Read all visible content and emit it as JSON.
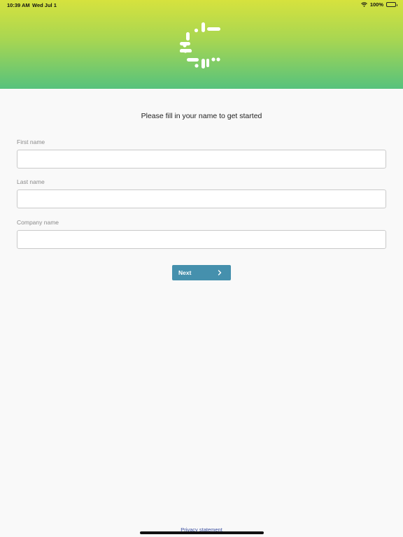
{
  "status_bar": {
    "time": "10:39 AM",
    "date": "Wed Jul 1",
    "battery": "100%"
  },
  "header": {
    "logo_icon": "dotted-c-logo-icon",
    "gradient_colors": [
      "#d6e23e",
      "#56c27d"
    ]
  },
  "form": {
    "prompt": "Please fill in your name to get started",
    "fields": [
      {
        "label": "First name",
        "value": ""
      },
      {
        "label": "Last name",
        "value": ""
      },
      {
        "label": "Company name",
        "value": ""
      }
    ],
    "next_button": {
      "label": "Next",
      "icon": "chevron-right-icon",
      "color": "#4590ad"
    }
  },
  "footer": {
    "privacy_link": "Privacy statement"
  }
}
